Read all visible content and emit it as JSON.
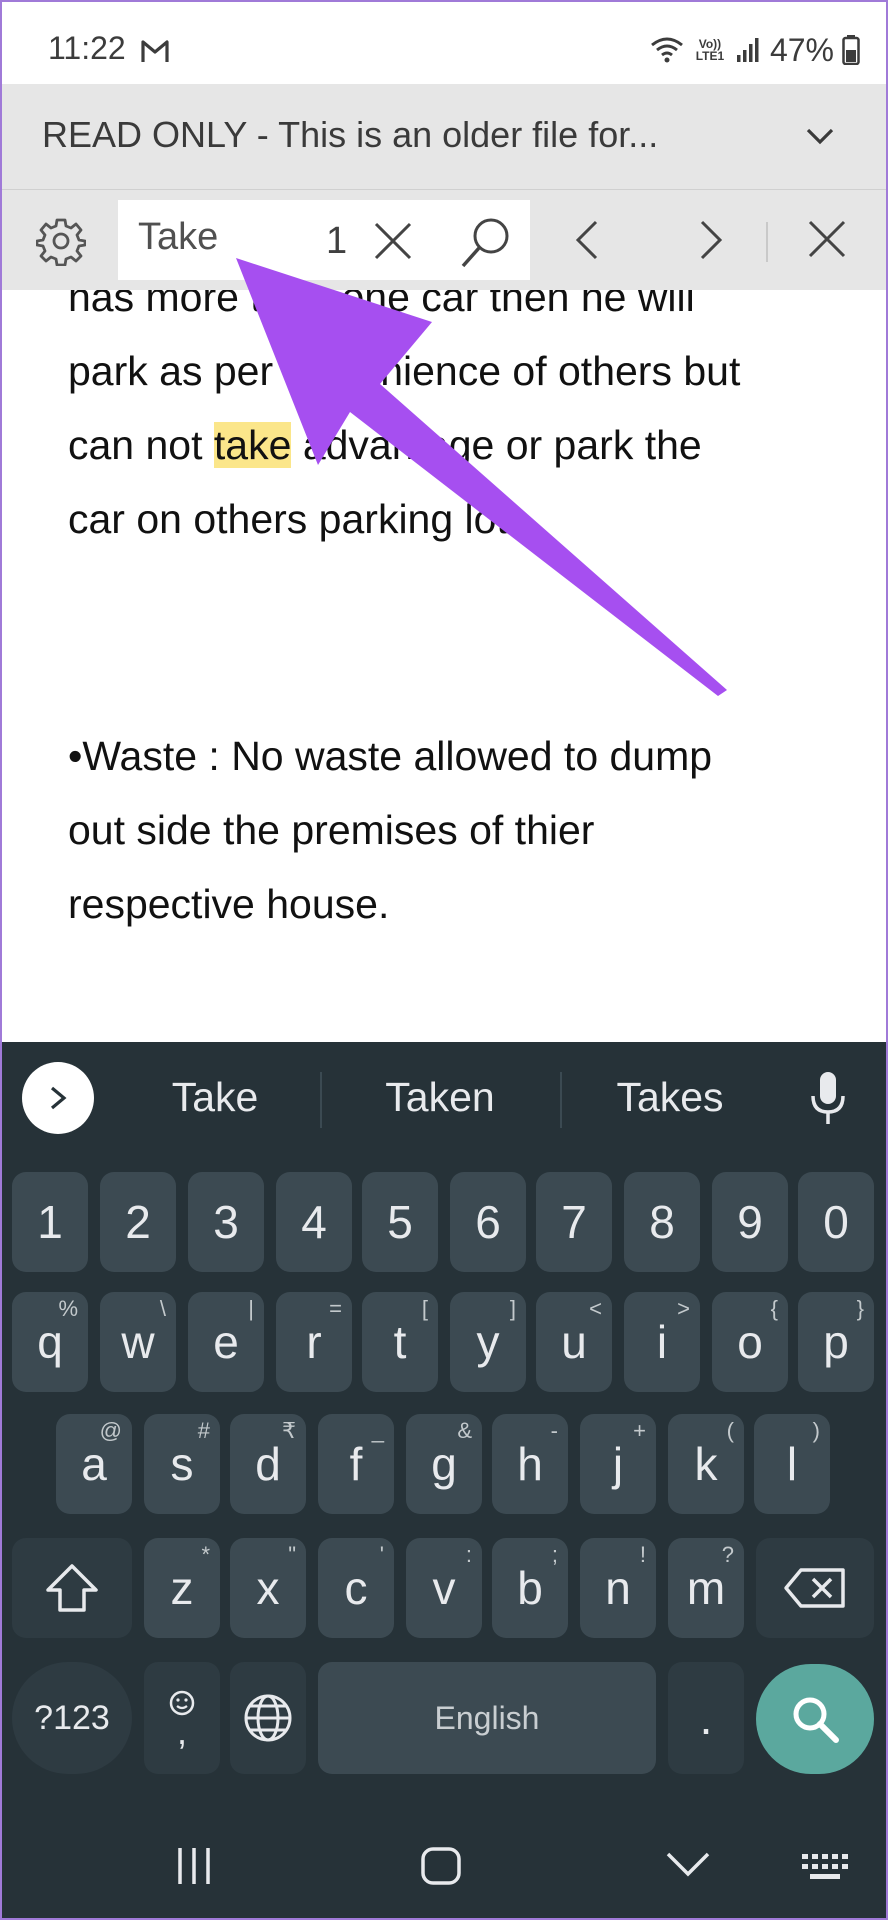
{
  "status_bar": {
    "time": "11:22",
    "network": "Vo)) LTE1",
    "battery": "47%",
    "icons": [
      "gmail-icon",
      "wifi-icon",
      "lte-icon",
      "signal-icon",
      "battery-icon"
    ]
  },
  "readonly_banner": {
    "text": "READ ONLY - This is an older file for..."
  },
  "find_bar": {
    "query": "Take",
    "match_count": "1"
  },
  "document": {
    "lines": [
      "has more than one car then he will",
      "park as per convinience of others but",
      "can not",
      "take",
      "advantage or park the",
      "car on others parking lot .",
      "•Waste : No waste allowed to dump",
      "out side the premises of thier",
      "respective house."
    ]
  },
  "keyboard": {
    "suggestions": [
      "Take",
      "Taken",
      "Takes"
    ],
    "number_row": [
      "1",
      "2",
      "3",
      "4",
      "5",
      "6",
      "7",
      "8",
      "9",
      "0"
    ],
    "row1": [
      {
        "key": "q",
        "sub": "%"
      },
      {
        "key": "w",
        "sub": "\\"
      },
      {
        "key": "e",
        "sub": "|"
      },
      {
        "key": "r",
        "sub": "="
      },
      {
        "key": "t",
        "sub": "["
      },
      {
        "key": "y",
        "sub": "]"
      },
      {
        "key": "u",
        "sub": "<"
      },
      {
        "key": "i",
        "sub": ">"
      },
      {
        "key": "o",
        "sub": "{"
      },
      {
        "key": "p",
        "sub": "}"
      }
    ],
    "row2": [
      {
        "key": "a",
        "sub": "@"
      },
      {
        "key": "s",
        "sub": "#"
      },
      {
        "key": "d",
        "sub": "₹"
      },
      {
        "key": "f",
        "sub": "_"
      },
      {
        "key": "g",
        "sub": "&"
      },
      {
        "key": "h",
        "sub": "-"
      },
      {
        "key": "j",
        "sub": "+"
      },
      {
        "key": "k",
        "sub": "("
      },
      {
        "key": "l",
        "sub": ")"
      }
    ],
    "row3": [
      {
        "key": "z",
        "sub": "*"
      },
      {
        "key": "x",
        "sub": "\""
      },
      {
        "key": "c",
        "sub": "'"
      },
      {
        "key": "v",
        "sub": ":"
      },
      {
        "key": "b",
        "sub": ";"
      },
      {
        "key": "n",
        "sub": "!"
      },
      {
        "key": "m",
        "sub": "?"
      }
    ],
    "symbols_label": "?123",
    "comma_key": ",",
    "space_label": "English",
    "period_key": "."
  },
  "colors": {
    "highlight": "#fbe68a",
    "arrow": "#a64ff0",
    "keyboard_bg": "#263238",
    "key_bg": "#3c4a52",
    "search_key": "#5ba89e"
  }
}
